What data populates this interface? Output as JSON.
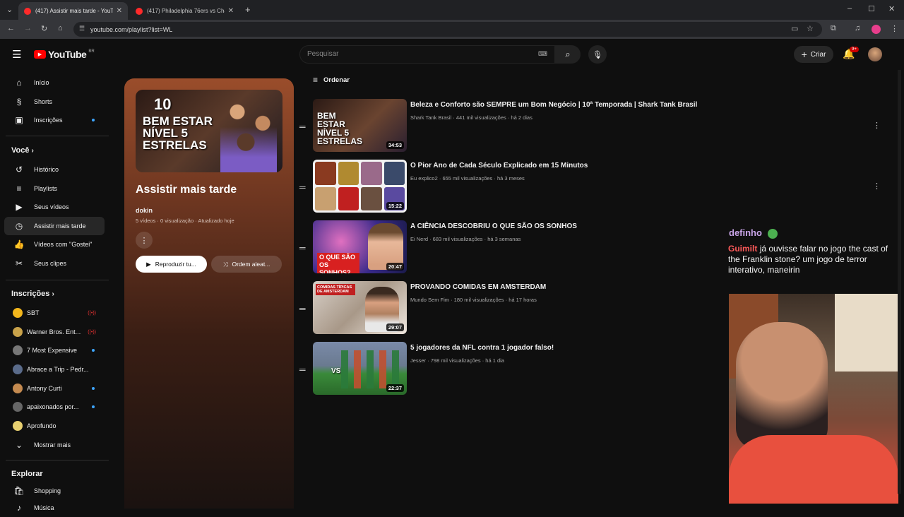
{
  "browser": {
    "tabs": [
      {
        "title": "(417) Assistir mais tarde - YouTu",
        "active": true
      },
      {
        "title": "(417) Philadelphia 76ers vs Char",
        "active": false
      }
    ],
    "url": "youtube.com/playlist?list=WL"
  },
  "header": {
    "logo": "YouTube",
    "region": "BR",
    "search_placeholder": "Pesquisar",
    "create_label": "Criar",
    "notifications_badge": "9+"
  },
  "sidebar": {
    "main": [
      {
        "label": "Início",
        "icon": "home-icon"
      },
      {
        "label": "Shorts",
        "icon": "shorts-icon"
      },
      {
        "label": "Inscrições",
        "icon": "subscriptions-icon"
      }
    ],
    "you_heading": "Você",
    "you": [
      {
        "label": "Histórico",
        "icon": "history-icon"
      },
      {
        "label": "Playlists",
        "icon": "playlists-icon"
      },
      {
        "label": "Seus vídeos",
        "icon": "your-videos-icon"
      },
      {
        "label": "Assistir mais tarde",
        "icon": "watch-later-icon"
      },
      {
        "label": "Vídeos com \"Gostei\"",
        "icon": "like-icon"
      },
      {
        "label": "Seus clipes",
        "icon": "scissors-icon"
      }
    ],
    "subs_heading": "Inscrições",
    "subscriptions": [
      {
        "label": "SBT",
        "status": "live",
        "color": "#f2b61c"
      },
      {
        "label": "Warner Bros. Ent...",
        "status": "live",
        "color": "#c8a24a"
      },
      {
        "label": "7 Most Expensive",
        "status": "new",
        "color": "#777777"
      },
      {
        "label": "Abrace a Trip - Pedr...",
        "status": "",
        "color": "#5a6b8a"
      },
      {
        "label": "Antony Curti",
        "status": "new",
        "color": "#c48a50"
      },
      {
        "label": "apaixonados por...",
        "status": "new",
        "color": "#666666"
      },
      {
        "label": "Aprofundo",
        "status": "",
        "color": "#e8d070"
      }
    ],
    "show_more": "Mostrar mais",
    "explore_heading": "Explorar",
    "explore": [
      {
        "label": "Shopping",
        "icon": "shopping-icon"
      },
      {
        "label": "Música",
        "icon": "music-icon"
      }
    ]
  },
  "playlist": {
    "thumb_text": "BEM ESTAR NÍVEL 5 ESTRELAS",
    "thumb_badge": "10",
    "title": "Assistir mais tarde",
    "owner": "dokin",
    "meta": "5 vídeos · 0 visualização · Atualizado hoje",
    "play_label": "Reproduzir tu...",
    "shuffle_label": "Ordem aleat..."
  },
  "list": {
    "sort_label": "Ordenar",
    "videos": [
      {
        "title": "Beleza e Conforto são SEMPRE um Bom Negócio | 10ª Temporada | Shark Tank Brasil",
        "meta": "Shark Tank Brasil · 441 mil visualizações · há 2 dias",
        "duration": "34:53",
        "thumb_text": "BEM ESTAR NÍVEL 5 ESTRELAS"
      },
      {
        "title": "O Pior Ano de Cada Século Explicado em 15 Minutos",
        "meta": "Eu explico2 · 655 mil visualizações · há 3 meses",
        "duration": "15:22",
        "thumb_text": ""
      },
      {
        "title": "A CIÊNCIA DESCOBRIU O QUE SÃO OS SONHOS",
        "meta": "Ei Nerd · 683 mil visualizações · há 3 semanas",
        "duration": "20:47",
        "thumb_text": "O QUE SÃO OS SONHOS?"
      },
      {
        "title": "PROVANDO COMIDAS EM AMSTERDAM",
        "meta": "Mundo Sem Fim · 180 mil visualizações · há 17 horas",
        "duration": "29:07",
        "thumb_text": "COMIDAS TÍPICAS DE AMSTERDAM"
      },
      {
        "title": "5 jogadores da NFL contra 1 jogador falso!",
        "meta": "Jesser · 798 mil visualizações · há 1 dia",
        "duration": "22:37",
        "thumb_text": "VS"
      }
    ]
  },
  "stream": {
    "chat_user": "definho",
    "chat_nick": "Guimilt",
    "chat_text": "já ouvisse falar no jogo the cast of the Franklin stone? um jogo de terror interativo, maneirin"
  }
}
